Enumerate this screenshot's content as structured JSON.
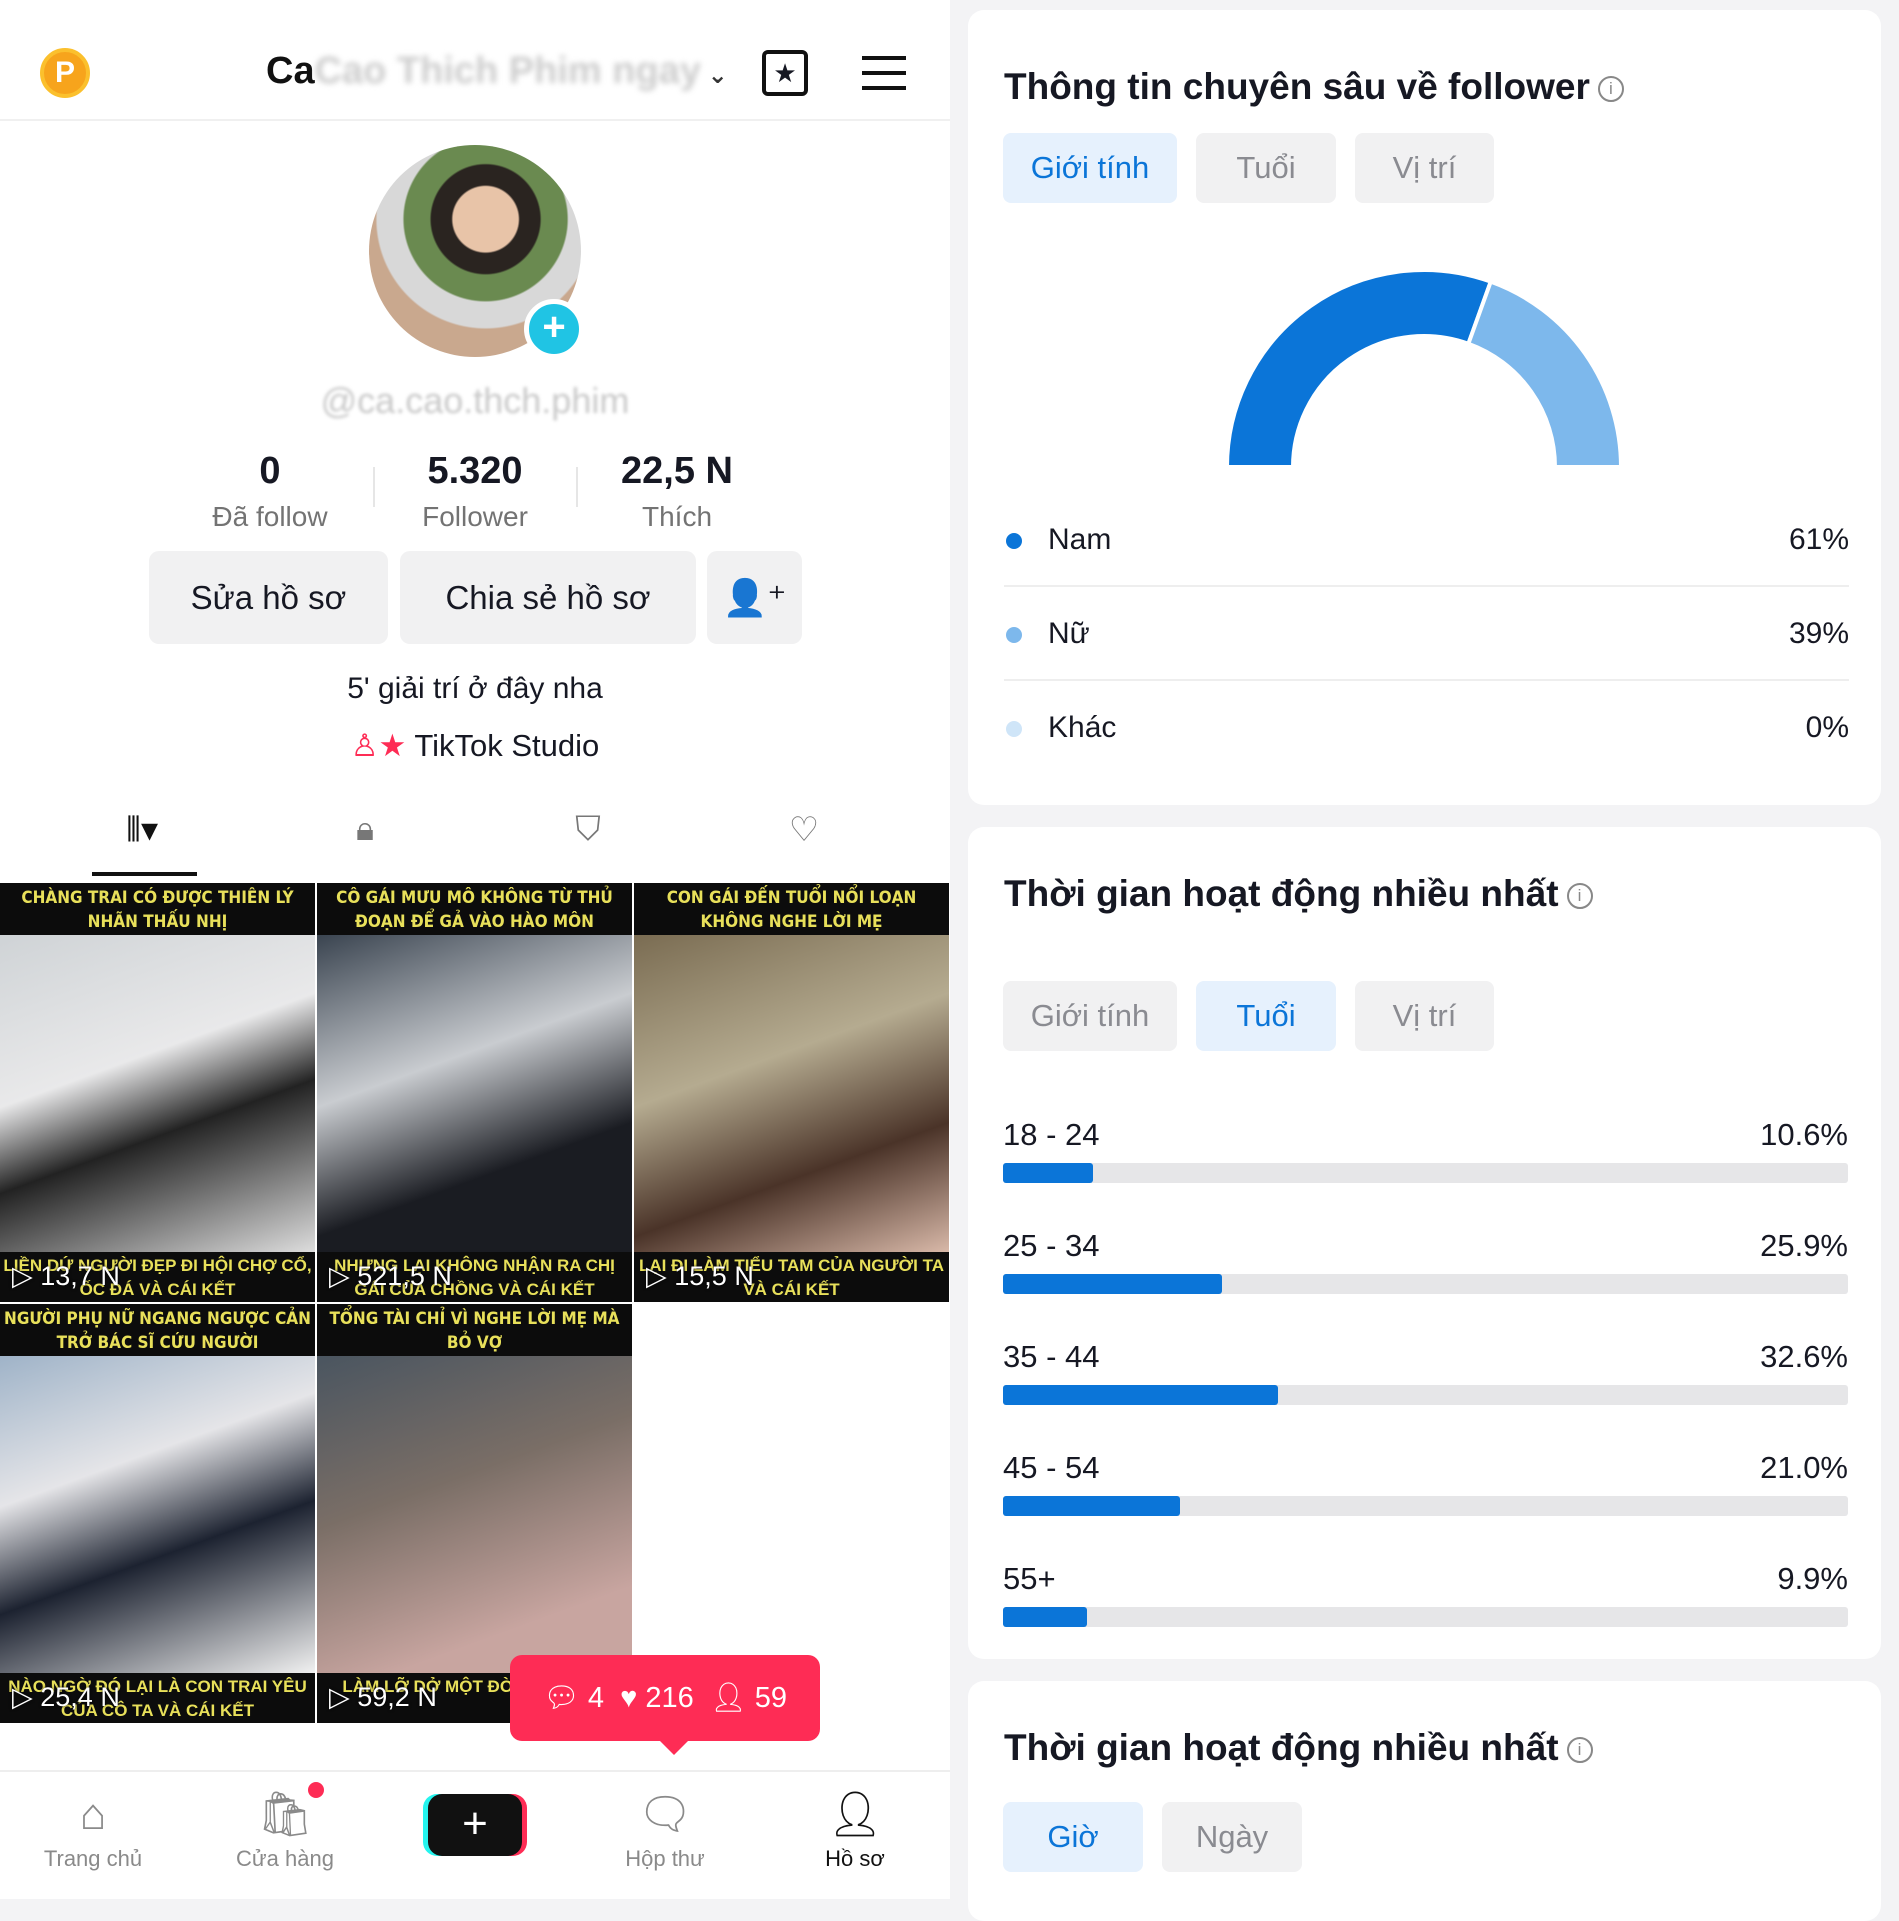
{
  "header": {
    "coin_label": "P",
    "title_visible": "Ca",
    "title_blurred": "Cao Thich Phim ngay",
    "icons": [
      "calendar-star-icon",
      "menu-icon"
    ]
  },
  "profile": {
    "username": "@ca.cao.thch.phim",
    "add_label": "+",
    "stats": [
      {
        "value": "0",
        "label": "Đã follow"
      },
      {
        "value": "5.320",
        "label": "Follower"
      },
      {
        "value": "22,5 N",
        "label": "Thích"
      }
    ],
    "edit_label": "Sửa hồ sơ",
    "share_label": "Chia sẻ hồ sơ",
    "bio": "5' giải trí ở đây nha",
    "studio_label": "TikTok Studio"
  },
  "videos": [
    {
      "top": "CHÀNG TRAI CÓ ĐƯỢC THIÊN LÝ NHÃN THẤU NHỊ",
      "bottom": "LIỀN DỨ NGƯỜI ĐẸP ĐI HỘI CHỢ CỔ, ỐC ĐÁ VÀ CÁI KẾT",
      "views": "13,7 N"
    },
    {
      "top": "CÔ GÁI MƯU MÔ KHÔNG TỪ THỦ ĐOẠN ĐỂ GẢ VÀO HÀO MÔN",
      "bottom": "NHƯNG LẠI KHÔNG NHẬN RA CHỊ GÁI CỦA CHỒNG VÀ CÁI KẾT",
      "views": "521,5 N"
    },
    {
      "top": "CON GÁI ĐẾN TUỔI NỔI LOẠN KHÔNG NGHE LỜI MẸ",
      "bottom": "LẠI ĐI LÀM TIỂU TAM CỦA NGƯỜI TA VÀ CÁI KẾT",
      "views": "15,5 N"
    },
    {
      "top": "NGƯỜI PHỤ NỮ NGANG NGƯỢC CẢN TRỞ BÁC SĨ CỨU NGƯỜI",
      "bottom": "NÀO NGỜ ĐÓ LẠI LÀ CON TRAI YÊU CỦA CÔ TA VÀ CÁI KẾT",
      "views": "25,4 N"
    },
    {
      "top": "TỔNG TÀI CHỈ VÌ NGHE LỜI MẸ MÀ BỎ VỢ",
      "bottom": "LÀM LỠ DỞ MỘT ĐỜI YÊU MÌNH",
      "views": "59,2 N"
    }
  ],
  "popup": {
    "comments": "4",
    "likes": "216",
    "followers": "59",
    "color": "#fe2c55"
  },
  "nav": [
    {
      "label": "Trang chủ"
    },
    {
      "label": "Cửa hàng"
    },
    {
      "label": "+"
    },
    {
      "label": "Hộp thư"
    },
    {
      "label": "Hồ sơ"
    }
  ],
  "insights": {
    "title": "Thông tin chuyên sâu về follower",
    "tabs": [
      "Giới tính",
      "Tuổi",
      "Vị trí"
    ],
    "active": "Giới tính",
    "gender": [
      {
        "label": "Nam",
        "value": 61,
        "text": "61%",
        "color": "#0b75d8"
      },
      {
        "label": "Nữ",
        "value": 39,
        "text": "39%",
        "color": "#7db8ec"
      },
      {
        "label": "Khác",
        "value": 0,
        "text": "0%",
        "color": "#cfe5f8"
      }
    ]
  },
  "activity": {
    "title": "Thời gian hoạt động nhiều nhất",
    "tabs": [
      "Giới tính",
      "Tuổi",
      "Vị trí"
    ],
    "active": "Tuổi",
    "ages": [
      {
        "label": "18 - 24",
        "value": 10.6,
        "text": "10.6%"
      },
      {
        "label": "25 - 34",
        "value": 25.9,
        "text": "25.9%"
      },
      {
        "label": "35 - 44",
        "value": 32.6,
        "text": "32.6%"
      },
      {
        "label": "45 - 54",
        "value": 21.0,
        "text": "21.0%"
      },
      {
        "label": "55+",
        "value": 9.9,
        "text": "9.9%"
      }
    ]
  },
  "activity_time": {
    "title": "Thời gian hoạt động nhiều nhất",
    "tabs": [
      "Giờ",
      "Ngày"
    ],
    "active": "Giờ"
  }
}
